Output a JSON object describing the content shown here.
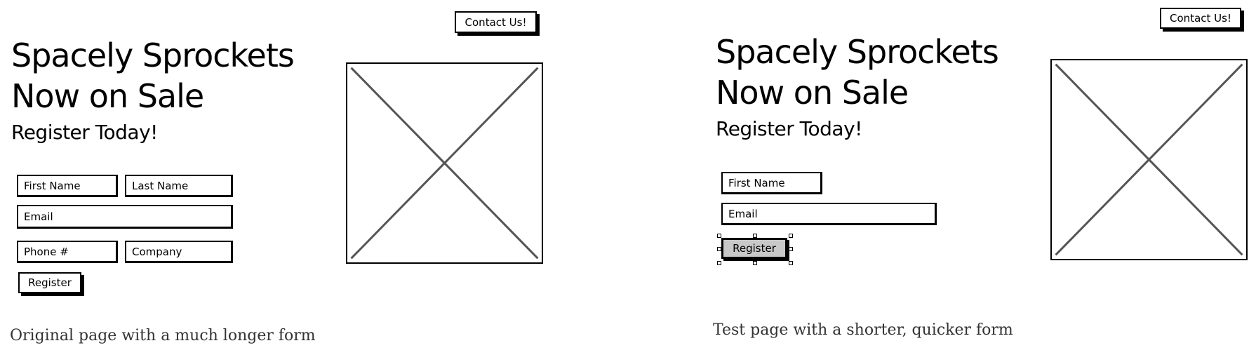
{
  "original": {
    "contact_button": "Contact Us!",
    "headline_line1": "Spacely Sprockets",
    "headline_line2": "Now on Sale",
    "subheadline": "Register Today!",
    "form": {
      "first_name": "First Name",
      "last_name": "Last Name",
      "email": "Email",
      "phone": "Phone #",
      "company": "Company",
      "register_button": "Register"
    },
    "image_placeholder": "image-placeholder-icon",
    "caption": "Original page with a much longer form"
  },
  "test": {
    "contact_button": "Contact Us!",
    "headline_line1": "Spacely Sprockets",
    "headline_line2": "Now on Sale",
    "subheadline": "Register Today!",
    "form": {
      "first_name": "First Name",
      "email": "Email",
      "register_button": "Register",
      "register_selected": true
    },
    "image_placeholder": "image-placeholder-icon",
    "caption": "Test page with a shorter, quicker form"
  },
  "colors": {
    "ink": "#000000",
    "selected_fill": "#c8c8c8",
    "caption_text": "#333333",
    "placeholder_x": "#555555"
  }
}
